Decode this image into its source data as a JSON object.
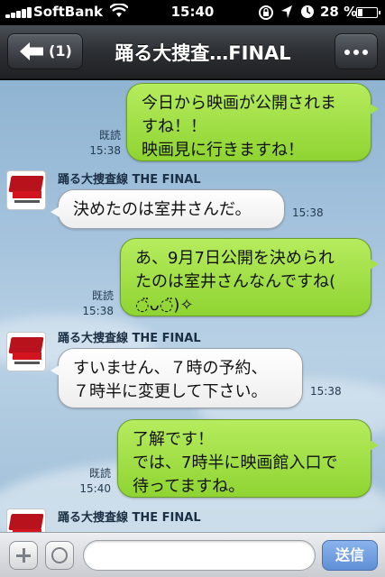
{
  "status_bar": {
    "carrier": "SoftBank",
    "time": "15:40",
    "battery_percent": "28 %",
    "battery_level": 0.28,
    "icons": [
      "signal-icon",
      "wifi-icon",
      "rotation-lock-icon",
      "location-icon",
      "alarm-icon",
      "battery-icon"
    ]
  },
  "nav": {
    "back_count": "(1)",
    "title": "踊る大捜査…FINAL",
    "icons": [
      "back-arrow-icon",
      "more-dots-icon"
    ]
  },
  "messages": [
    {
      "direction": "out",
      "lines": [
        "今日から映画が公開されま",
        "すね！！",
        "映画見に行きますね！"
      ],
      "read": "既読",
      "time": "15:38"
    },
    {
      "direction": "in",
      "sender": "踊る大捜査線 THE FINAL",
      "lines": [
        "決めたのは室井さんだ。"
      ],
      "time": "15:38"
    },
    {
      "direction": "out",
      "lines": [
        "あ、9月7日公開を決められ",
        "たのは室井さんなんですね(",
        "◌̈ᴗ◌̈)✧"
      ],
      "read": "既読",
      "time": "15:38"
    },
    {
      "direction": "in",
      "sender": "踊る大捜査線 THE FINAL",
      "lines": [
        "すいません、７時の予約、",
        "７時半に変更して下さい。"
      ],
      "time": "15:38"
    },
    {
      "direction": "out",
      "lines": [
        "了解です！",
        "では、7時半に映画館入口で",
        "待ってますね。"
      ],
      "read": "既読",
      "time": "15:40"
    },
    {
      "direction": "in",
      "sender": "踊る大捜査線 THE FINAL",
      "lines": [],
      "time": ""
    }
  ],
  "input_bar": {
    "placeholder": "",
    "send_label": "送信",
    "icons": [
      "plus-icon",
      "emoji-icon"
    ]
  }
}
